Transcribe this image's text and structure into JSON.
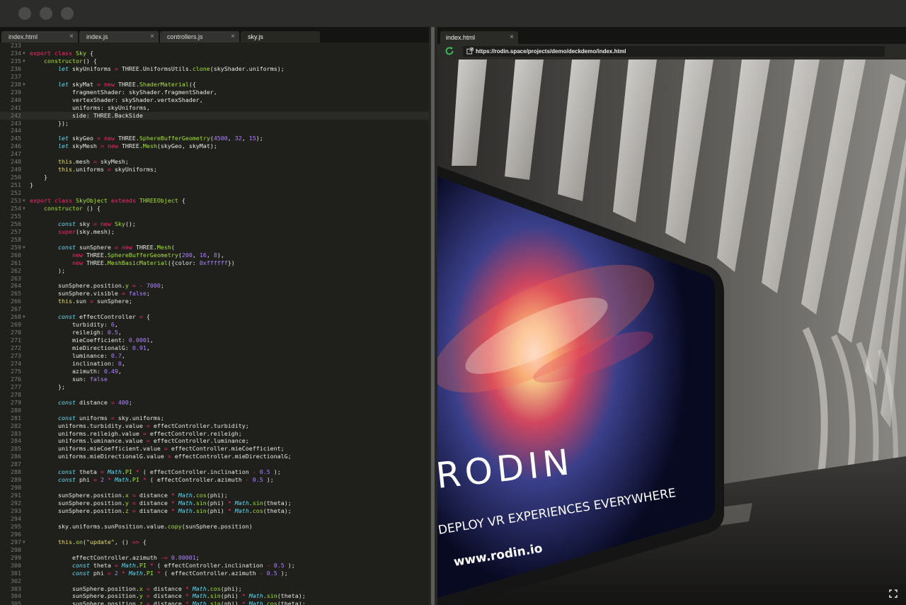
{
  "editor": {
    "tabs": [
      {
        "label": "index.html",
        "active": false
      },
      {
        "label": "index.js",
        "active": false
      },
      {
        "label": "controllers.js",
        "active": false
      },
      {
        "label": "sky.js",
        "active": true
      }
    ],
    "highlighted_line": 242,
    "lines": [
      {
        "n": 233,
        "fold": false,
        "html": ""
      },
      {
        "n": 234,
        "fold": true,
        "html": "<span class='k'>export class</span> <span class='c'>Sky</span> {"
      },
      {
        "n": 235,
        "fold": true,
        "html": "    <span class='c'>constructor</span>() {"
      },
      {
        "n": 236,
        "fold": false,
        "html": "        <span class='s'>let</span> skyUniforms <span class='o'>=</span> THREE.UniformsUtils.<span class='c'>clone</span>(skyShader.uniforms);"
      },
      {
        "n": 237,
        "fold": false,
        "html": ""
      },
      {
        "n": 238,
        "fold": true,
        "html": "        <span class='s'>let</span> skyMat <span class='o'>=</span> <span class='k'>new</span> THREE.<span class='c'>ShaderMaterial</span>({"
      },
      {
        "n": 239,
        "fold": false,
        "html": "            fragmentShader: skyShader.fragmentShader,"
      },
      {
        "n": 240,
        "fold": false,
        "html": "            vertexShader: skyShader.vertexShader,"
      },
      {
        "n": 241,
        "fold": false,
        "html": "            uniforms: skyUniforms,"
      },
      {
        "n": 242,
        "fold": false,
        "html": "            side: THREE.BackSide"
      },
      {
        "n": 243,
        "fold": false,
        "html": "        });"
      },
      {
        "n": 244,
        "fold": false,
        "html": ""
      },
      {
        "n": 245,
        "fold": false,
        "html": "        <span class='s'>let</span> skyGeo <span class='o'>=</span> <span class='k'>new</span> THREE.<span class='c'>SphereBufferGeometry</span>(<span class='n'>4500</span>, <span class='n'>32</span>, <span class='n'>15</span>);"
      },
      {
        "n": 246,
        "fold": false,
        "html": "        <span class='s'>let</span> skyMesh <span class='o'>=</span> <span class='k'>new</span> THREE.<span class='c'>Mesh</span>(skyGeo, skyMat);"
      },
      {
        "n": 247,
        "fold": false,
        "html": ""
      },
      {
        "n": 248,
        "fold": false,
        "html": "        <span class='t'>this</span>.mesh <span class='o'>=</span> skyMesh;"
      },
      {
        "n": 249,
        "fold": false,
        "html": "        <span class='t'>this</span>.uniforms <span class='o'>=</span> skyUniforms;"
      },
      {
        "n": 250,
        "fold": false,
        "html": "    }"
      },
      {
        "n": 251,
        "fold": false,
        "html": "}"
      },
      {
        "n": 252,
        "fold": false,
        "html": ""
      },
      {
        "n": 253,
        "fold": true,
        "html": "<span class='k'>export class</span> <span class='c'>SkyObject</span> <span class='k'>extends</span> <span class='c'>THREEObject</span> {"
      },
      {
        "n": 254,
        "fold": true,
        "html": "    <span class='c'>constructor</span> () {"
      },
      {
        "n": 255,
        "fold": false,
        "html": ""
      },
      {
        "n": 256,
        "fold": false,
        "html": "        <span class='s'>const</span> sky <span class='o'>=</span> <span class='k'>new</span> <span class='c'>Sky</span>();"
      },
      {
        "n": 257,
        "fold": false,
        "html": "        <span class='k'>super</span>(sky.mesh);"
      },
      {
        "n": 258,
        "fold": false,
        "html": ""
      },
      {
        "n": 259,
        "fold": true,
        "html": "        <span class='s'>const</span> sunSphere <span class='o'>=</span> <span class='k'>new</span> THREE.<span class='c'>Mesh</span>("
      },
      {
        "n": 260,
        "fold": false,
        "html": "            <span class='k'>new</span> THREE.<span class='c'>SphereBufferGeometry</span>(<span class='n'>200</span>, <span class='n'>16</span>, <span class='n'>8</span>),"
      },
      {
        "n": 261,
        "fold": false,
        "html": "            <span class='k'>new</span> THREE.<span class='c'>MeshBasicMaterial</span>({color: <span class='n'>0xffffff</span>})"
      },
      {
        "n": 262,
        "fold": false,
        "html": "        );"
      },
      {
        "n": 263,
        "fold": false,
        "html": ""
      },
      {
        "n": 264,
        "fold": false,
        "html": "        sunSphere.position.<span class='c'>y</span> <span class='o'>=</span> <span class='o'>-</span> <span class='n'>7000</span>;"
      },
      {
        "n": 265,
        "fold": false,
        "html": "        sunSphere.visible <span class='o'>=</span> <span class='n'>false</span>;"
      },
      {
        "n": 266,
        "fold": false,
        "html": "        <span class='t'>this</span>.sun <span class='o'>=</span> sunSphere;"
      },
      {
        "n": 267,
        "fold": false,
        "html": ""
      },
      {
        "n": 268,
        "fold": true,
        "html": "        <span class='s'>const</span> effectController <span class='o'>=</span> {"
      },
      {
        "n": 269,
        "fold": false,
        "html": "            turbidity: <span class='n'>6</span>,"
      },
      {
        "n": 270,
        "fold": false,
        "html": "            reileigh: <span class='n'>0.5</span>,"
      },
      {
        "n": 271,
        "fold": false,
        "html": "            mieCoefficient: <span class='n'>0.0001</span>,"
      },
      {
        "n": 272,
        "fold": false,
        "html": "            mieDirectionalG: <span class='n'>0.91</span>,"
      },
      {
        "n": 273,
        "fold": false,
        "html": "            luminance: <span class='n'>0.7</span>,"
      },
      {
        "n": 274,
        "fold": false,
        "html": "            inclination: <span class='n'>0</span>,"
      },
      {
        "n": 275,
        "fold": false,
        "html": "            azimuth: <span class='n'>0.49</span>,"
      },
      {
        "n": 276,
        "fold": false,
        "html": "            sun: <span class='n'>false</span>"
      },
      {
        "n": 277,
        "fold": false,
        "html": "        };"
      },
      {
        "n": 278,
        "fold": false,
        "html": ""
      },
      {
        "n": 279,
        "fold": false,
        "html": "        <span class='s'>const</span> distance <span class='o'>=</span> <span class='n'>400</span>;"
      },
      {
        "n": 280,
        "fold": false,
        "html": ""
      },
      {
        "n": 281,
        "fold": false,
        "html": "        <span class='s'>const</span> uniforms <span class='o'>=</span> sky.uniforms;"
      },
      {
        "n": 282,
        "fold": false,
        "html": "        uniforms.turbidity.value <span class='o'>=</span> effectController.turbidity;"
      },
      {
        "n": 283,
        "fold": false,
        "html": "        uniforms.reileigh.value <span class='o'>=</span> effectController.reileigh;"
      },
      {
        "n": 284,
        "fold": false,
        "html": "        uniforms.luminance.value <span class='o'>=</span> effectController.luminance;"
      },
      {
        "n": 285,
        "fold": false,
        "html": "        uniforms.mieCoefficient.value <span class='o'>=</span> effectController.mieCoefficient;"
      },
      {
        "n": 286,
        "fold": false,
        "html": "        uniforms.mieDirectionalG.value <span class='o'>=</span> effectController.mieDirectionalG;"
      },
      {
        "n": 287,
        "fold": false,
        "html": ""
      },
      {
        "n": 288,
        "fold": false,
        "html": "        <span class='s'>const</span> theta <span class='o'>=</span> <span class='s'>Math</span>.<span class='c'>PI</span> <span class='o'>*</span> ( effectController.inclination <span class='o'>-</span> <span class='n'>0.5</span> );"
      },
      {
        "n": 289,
        "fold": false,
        "html": "        <span class='s'>const</span> phi <span class='o'>=</span> <span class='n'>2</span> <span class='o'>*</span> <span class='s'>Math</span>.<span class='c'>PI</span> <span class='o'>*</span> ( effectController.azimuth <span class='o'>-</span> <span class='n'>0.5</span> );"
      },
      {
        "n": 290,
        "fold": false,
        "html": ""
      },
      {
        "n": 291,
        "fold": false,
        "html": "        sunSphere.position.<span class='c'>x</span> <span class='o'>=</span> distance <span class='o'>*</span> <span class='s'>Math</span>.<span class='c'>cos</span>(phi);"
      },
      {
        "n": 292,
        "fold": false,
        "html": "        sunSphere.position.<span class='c'>y</span> <span class='o'>=</span> distance <span class='o'>*</span> <span class='s'>Math</span>.<span class='c'>sin</span>(phi) <span class='o'>*</span> <span class='s'>Math</span>.<span class='c'>sin</span>(theta);"
      },
      {
        "n": 293,
        "fold": false,
        "html": "        sunSphere.position.<span class='c'>z</span> <span class='o'>=</span> distance <span class='o'>*</span> <span class='s'>Math</span>.<span class='c'>sin</span>(phi) <span class='o'>*</span> <span class='s'>Math</span>.<span class='c'>cos</span>(theta);"
      },
      {
        "n": 294,
        "fold": false,
        "html": ""
      },
      {
        "n": 295,
        "fold": false,
        "html": "        sky.uniforms.sunPosition.value.<span class='c'>copy</span>(sunSphere.position)"
      },
      {
        "n": 296,
        "fold": false,
        "html": ""
      },
      {
        "n": 297,
        "fold": true,
        "html": "        <span class='t'>this</span>.<span class='c'>on</span>(<span class='t'>\"update\"</span>, () <span class='o'>=></span> {"
      },
      {
        "n": 298,
        "fold": false,
        "html": ""
      },
      {
        "n": 299,
        "fold": false,
        "html": "            effectController.azimuth <span class='o'>-=</span> <span class='n'>0.00001</span>;"
      },
      {
        "n": 300,
        "fold": false,
        "html": "            <span class='s'>const</span> theta <span class='o'>=</span> <span class='s'>Math</span>.<span class='c'>PI</span> <span class='o'>*</span> ( effectController.inclination <span class='o'>-</span> <span class='n'>0.5</span> );"
      },
      {
        "n": 301,
        "fold": false,
        "html": "            <span class='s'>const</span> phi <span class='o'>=</span> <span class='n'>2</span> <span class='o'>*</span> <span class='s'>Math</span>.<span class='c'>PI</span> <span class='o'>*</span> ( effectController.azimuth <span class='o'>-</span> <span class='n'>0.5</span> );"
      },
      {
        "n": 302,
        "fold": false,
        "html": ""
      },
      {
        "n": 303,
        "fold": false,
        "html": "            sunSphere.position.<span class='c'>x</span> <span class='o'>=</span> distance <span class='o'>*</span> <span class='s'>Math</span>.<span class='c'>cos</span>(phi);"
      },
      {
        "n": 304,
        "fold": false,
        "html": "            sunSphere.position.<span class='c'>y</span> <span class='o'>=</span> distance <span class='o'>*</span> <span class='s'>Math</span>.<span class='c'>sin</span>(phi) <span class='o'>*</span> <span class='s'>Math</span>.<span class='c'>sin</span>(theta);"
      },
      {
        "n": 305,
        "fold": false,
        "html": "            sunSphere.position.<span class='c'>z</span> <span class='o'>=</span> distance <span class='o'>*</span> <span class='s'>Math</span>.<span class='c'>sin</span>(phi) <span class='o'>*</span> <span class='s'>Math</span>.<span class='c'>cos</span>(theta);"
      }
    ]
  },
  "browser": {
    "tab_label": "index.html",
    "url": "https://rodin.space/projects/demo/deckdemo/index.html",
    "reload_icon": "reload-icon",
    "url_icon": "external-link-icon",
    "fullscreen_icon": "fullscreen-icon",
    "scene": {
      "logo": "RODIN",
      "tagline": "DEPLOY VR EXPERIENCES EVERYWHERE",
      "website": "www.rodin.io"
    }
  },
  "colors": {
    "reload_green": "#3cc45a",
    "keyword_pink": "#f92672",
    "function_green": "#a6e22e",
    "number_purple": "#ae81ff",
    "storage_blue": "#66d9ef",
    "string_yellow": "#e6db74"
  }
}
